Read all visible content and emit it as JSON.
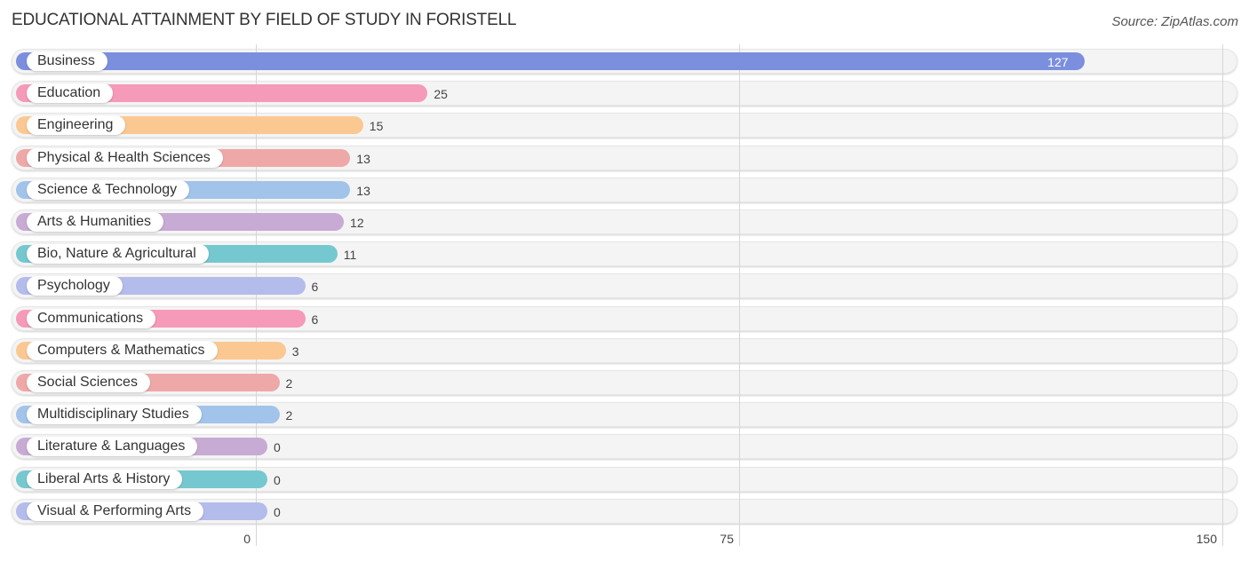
{
  "title": "EDUCATIONAL ATTAINMENT BY FIELD OF STUDY IN FORISTELL",
  "source": "Source: ZipAtlas.com",
  "chart_data": {
    "type": "bar",
    "orientation": "horizontal",
    "title": "EDUCATIONAL ATTAINMENT BY FIELD OF STUDY IN FORISTELL",
    "xlabel": "",
    "ylabel": "",
    "xlim": [
      0,
      150
    ],
    "xticks": [
      "0",
      "75",
      "150"
    ],
    "grid": true,
    "categories": [
      "Business",
      "Education",
      "Engineering",
      "Physical & Health Sciences",
      "Science & Technology",
      "Arts & Humanities",
      "Bio, Nature & Agricultural",
      "Psychology",
      "Communications",
      "Computers & Mathematics",
      "Social Sciences",
      "Multidisciplinary Studies",
      "Literature & Languages",
      "Liberal Arts & History",
      "Visual & Performing Arts"
    ],
    "values": [
      127,
      25,
      15,
      13,
      13,
      12,
      11,
      6,
      6,
      3,
      2,
      2,
      0,
      0,
      0
    ],
    "colors": [
      "#7b8fde",
      "#f59ab8",
      "#fbc892",
      "#efa8a8",
      "#a2c3ea",
      "#c7abd4",
      "#75c8cf",
      "#b3bceb",
      "#f59ab8",
      "#fbc892",
      "#efa8a8",
      "#a2c3ea",
      "#c7abd4",
      "#75c8cf",
      "#b3bceb"
    ]
  }
}
